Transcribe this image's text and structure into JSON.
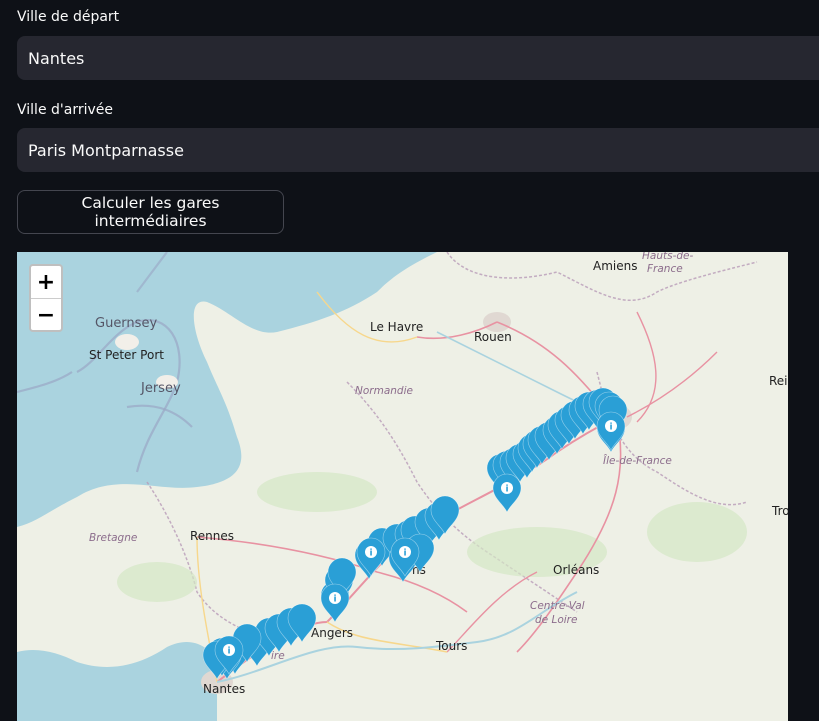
{
  "form": {
    "departure_label": "Ville de départ",
    "departure_value": "Nantes",
    "arrival_label": "Ville d'arrivée",
    "arrival_value": "Paris Montparnasse",
    "compute_button": "Calculer les gares intermédiaires"
  },
  "map": {
    "zoom_in": "+",
    "zoom_out": "−",
    "labels": {
      "guernsey": "Guernsey",
      "st_peter_port": "St Peter Port",
      "jersey": "Jersey",
      "le_havre": "Le Havre",
      "rouen": "Rouen",
      "amiens": "Amiens",
      "hauts_de_france_1": "Hauts-de-",
      "hauts_de_france_2": "France",
      "normandie": "Normandie",
      "ile_de_france": "Île-de-France",
      "bretagne": "Bretagne",
      "rennes": "Rennes",
      "le_mans_partial": "ns",
      "orleans": "Orléans",
      "centre_1": "Centre-Val",
      "centre_2": "de Loire",
      "angers": "Angers",
      "tours": "Tours",
      "nantes": "Nantes",
      "loire_partial": "ire",
      "reims_partial": "Rei",
      "troyes_partial": "Tro"
    },
    "marker_color": "#2a9fd6",
    "marker_icon": "info-icon"
  }
}
